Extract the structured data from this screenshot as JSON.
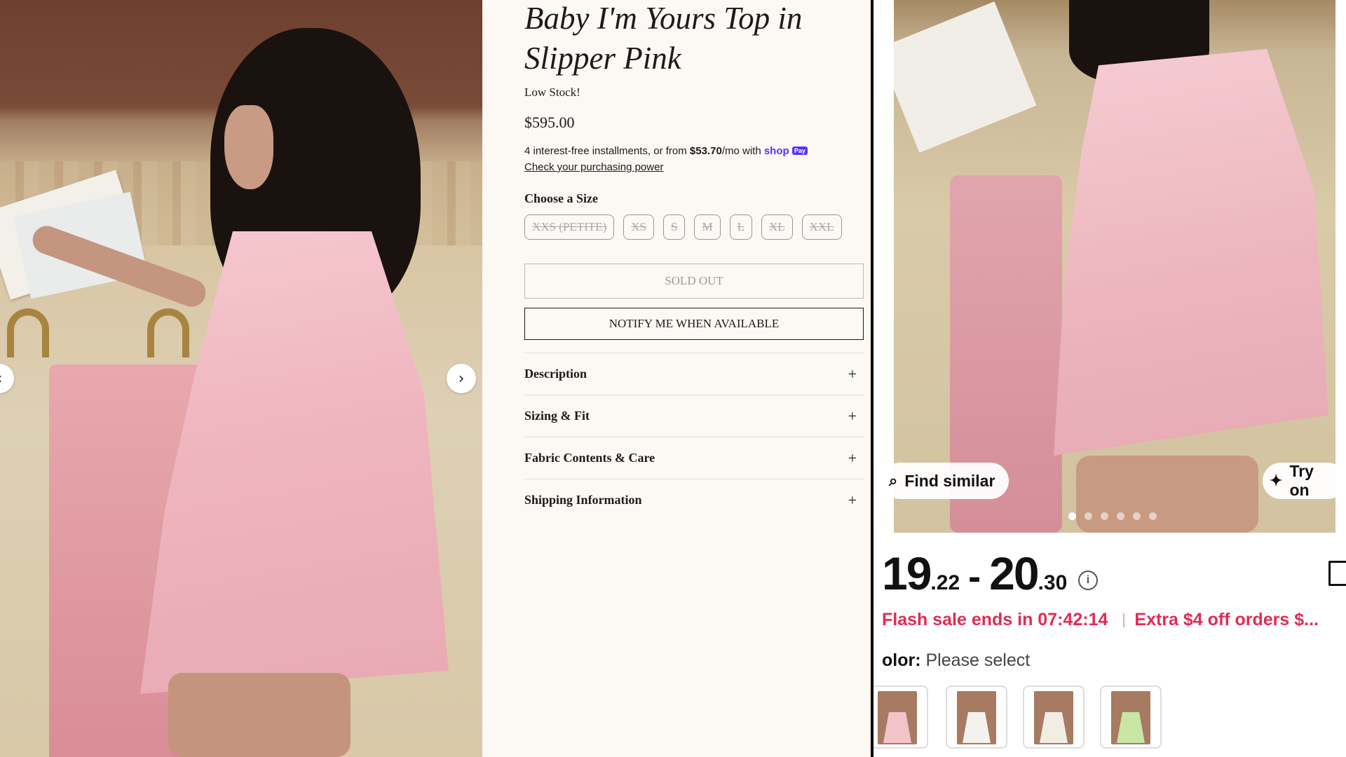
{
  "product": {
    "title": "Baby I'm Yours Top in Slipper Pink",
    "stock": "Low Stock!",
    "price": "$595.00",
    "installments_prefix": "4 interest-free installments, or from",
    "installments_amount": "$53.70",
    "installments_suffix": "/mo with",
    "shop_brand": "shop",
    "shop_pay_badge": "Pay",
    "check_link": "Check your purchasing power",
    "size_label": "Choose a Size",
    "sizes": [
      "XXS (PETITE)",
      "XS",
      "S",
      "M",
      "L",
      "XL",
      "XXL"
    ],
    "sold_out_label": "SOLD OUT",
    "notify_label": "NOTIFY ME WHEN AVAILABLE",
    "accordion": [
      "Description",
      "Sizing & Fit",
      "Fabric Contents & Care",
      "Shipping Information"
    ],
    "plus_glyph": "+"
  },
  "gallery": {
    "prev_glyph": "‹",
    "next_glyph": "›"
  },
  "app": {
    "find_similar": "Find similar",
    "try_on": "Try on",
    "carousel_dots": 6,
    "carousel_active": 0,
    "price_low_int": "19",
    "price_low_dec": ".22",
    "price_dash": "-",
    "price_high_int": "20",
    "price_high_dec": ".30",
    "info_glyph": "i",
    "flash_text": "Flash sale ends in 07:42:14",
    "extra_text": "Extra $4 off orders $...",
    "color_label": "olor:",
    "color_value": "Please select",
    "swatch_colors": [
      "#f2c4c8",
      "#f4f2ee",
      "#f1ede2",
      "#c9e6a4"
    ]
  },
  "colors": {
    "accent_flash": "#e22b55",
    "shop_pay": "#5a31f4",
    "panel_bg": "#fcf8f4"
  }
}
